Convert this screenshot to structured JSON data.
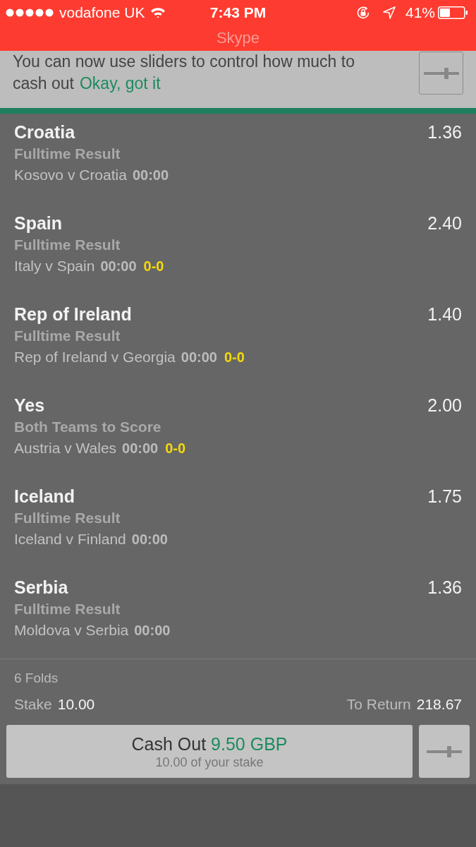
{
  "status_bar": {
    "carrier": "vodafone UK",
    "time": "7:43 PM",
    "battery": "41%"
  },
  "call_banner": {
    "label": "Skype"
  },
  "notice": {
    "text": "You can now use sliders to control how much to cash out",
    "link": "Okay, got it"
  },
  "bets": [
    {
      "selection": "Croatia",
      "odds": "1.36",
      "market": "Fulltime Result",
      "event": "Kosovo v Croatia",
      "clock": "00:00"
    },
    {
      "selection": "Spain",
      "odds": "2.40",
      "market": "Fulltime Result",
      "event": "Italy v Spain",
      "clock": "00:00",
      "score": "0-0"
    },
    {
      "selection": "Rep of Ireland",
      "odds": "1.40",
      "market": "Fulltime Result",
      "event": "Rep of Ireland v Georgia",
      "clock": "00:00",
      "score": "0-0"
    },
    {
      "selection": "Yes",
      "odds": "2.00",
      "market": "Both Teams to Score",
      "event": "Austria v Wales",
      "clock": "00:00",
      "score": "0-0"
    },
    {
      "selection": "Iceland",
      "odds": "1.75",
      "market": "Fulltime Result",
      "event": "Iceland v Finland",
      "clock": "00:00"
    },
    {
      "selection": "Serbia",
      "odds": "1.36",
      "market": "Fulltime Result",
      "event": "Moldova v Serbia",
      "clock": "00:00"
    }
  ],
  "summary": {
    "bet_type": "6 Folds",
    "stake_label": "Stake",
    "stake": "10.00",
    "return_label": "To Return",
    "return": "218.67"
  },
  "cash_out": {
    "label": "Cash Out",
    "amount": "9.50 GBP",
    "note": "10.00 of your stake"
  }
}
